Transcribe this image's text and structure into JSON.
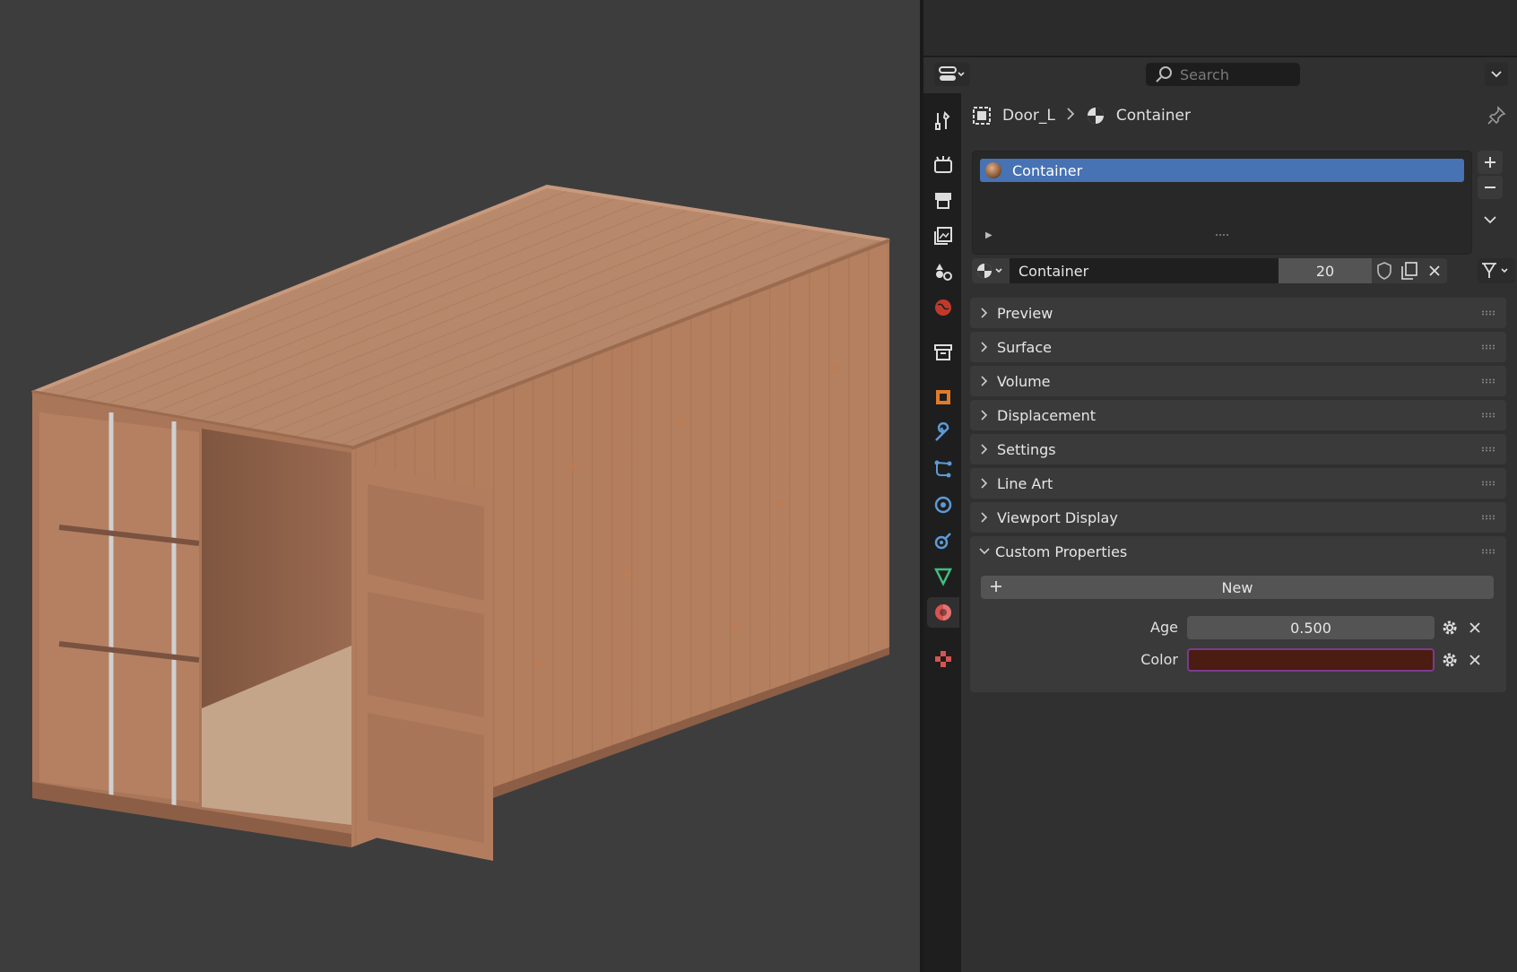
{
  "header": {
    "search_placeholder": "Search"
  },
  "breadcrumb": {
    "object": "Door_L",
    "material": "Container"
  },
  "material_slots": {
    "items": [
      {
        "label": "Container"
      }
    ]
  },
  "material": {
    "name": "Container",
    "users": "20"
  },
  "panels": {
    "preview": "Preview",
    "surface": "Surface",
    "volume": "Volume",
    "displacement": "Displacement",
    "settings": "Settings",
    "line_art": "Line Art",
    "viewport_display": "Viewport Display",
    "custom_properties": "Custom Properties"
  },
  "custom_properties": {
    "new_label": "New",
    "props": [
      {
        "label": "Age",
        "value": "0.500"
      },
      {
        "label": "Color",
        "value": "",
        "color": "#4a1c12"
      }
    ]
  },
  "tabs": [
    "tool-tab",
    "render-tab",
    "output-tab",
    "view-layer-tab",
    "scene-tab",
    "world-tab",
    "collection-tab",
    "object-tab",
    "modifier-tab",
    "particles-tab",
    "physics-tab",
    "constraints-tab",
    "data-tab",
    "material-tab",
    "texture-tab"
  ],
  "colors": {
    "accent": "#4772b3",
    "panel_bg": "#303030",
    "viewport_bg": "#3d3d3d",
    "container": "#b07a5c"
  }
}
